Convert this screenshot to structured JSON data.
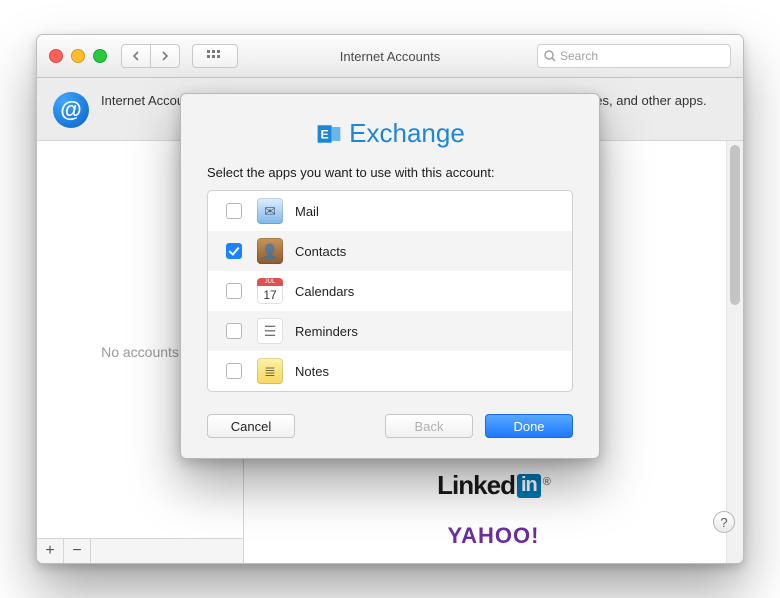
{
  "window": {
    "title": "Internet Accounts",
    "search_placeholder": "Search"
  },
  "description": "Internet Accounts sets up your accounts to use with Mail, Contacts, Calendar, Messages, and other apps.",
  "sidebar": {
    "empty_label": "No accounts",
    "add_label": "+",
    "remove_label": "−"
  },
  "providers": {
    "linkedin_a": "Linked",
    "linkedin_b": "in",
    "yahoo": "YAHOO!"
  },
  "help": "?",
  "sheet": {
    "brand": "Exchange",
    "instruction": "Select the apps you want to use with this account:",
    "apps": [
      {
        "label": "Mail",
        "checked": false,
        "icon": "mail-icon",
        "bg": "linear-gradient(#dfefff,#7fb6ea)",
        "glyph": "✉︎"
      },
      {
        "label": "Contacts",
        "checked": true,
        "icon": "contacts-icon",
        "bg": "linear-gradient(#c89558,#8c5a2d)",
        "glyph": "👤"
      },
      {
        "label": "Calendars",
        "checked": false,
        "icon": "calendar-icon",
        "bg": "#ffffff",
        "glyph": "17"
      },
      {
        "label": "Reminders",
        "checked": false,
        "icon": "reminders-icon",
        "bg": "#ffffff",
        "glyph": "☰"
      },
      {
        "label": "Notes",
        "checked": false,
        "icon": "notes-icon",
        "bg": "linear-gradient(#fff2a8,#f5d75e)",
        "glyph": "≣"
      }
    ],
    "cancel": "Cancel",
    "back": "Back",
    "done": "Done"
  }
}
